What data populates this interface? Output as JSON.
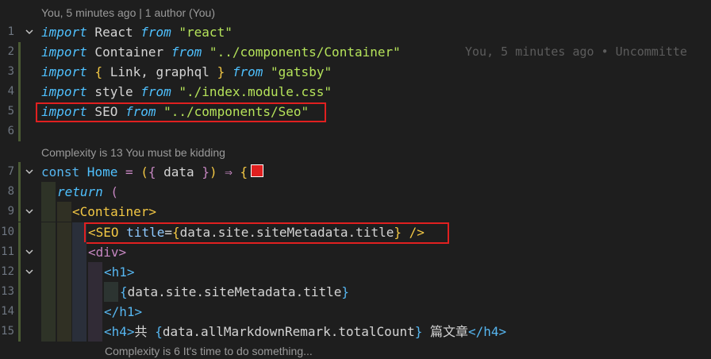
{
  "blame_header": "You, 5 minutes ago | 1 author (You)",
  "complexity_1": "Complexity is 13 You must be kidding",
  "complexity_2": "Complexity is 6 It's time to do something...",
  "blame_inline": "You, 5 minutes ago • Uncommitte",
  "line_numbers": [
    "1",
    "2",
    "3",
    "4",
    "5",
    "6",
    "7",
    "8",
    "9",
    "10",
    "11",
    "12",
    "13",
    "14",
    "15"
  ],
  "code": {
    "l1": {
      "kw": "import",
      "name": " React ",
      "from": "from",
      "str": " \"react\""
    },
    "l2": {
      "kw": "import",
      "name": " Container ",
      "from": "from",
      "str": " \"../components/Container\""
    },
    "l3": {
      "kw": "import",
      "b1": "{",
      "names": " Link, graphql ",
      "b2": "}",
      "from": "from",
      "str": " \"gatsby\""
    },
    "l4": {
      "kw": "import",
      "name": " style ",
      "from": "from",
      "str": " \"./index.module.css\""
    },
    "l5": {
      "kw": "import",
      "name": " SEO ",
      "from": "from",
      "str": " \"../components/Seo\""
    },
    "l7": {
      "const": "const",
      "name": " Home ",
      "eq": "=",
      "p1": " (",
      "b1": "{",
      "arg": " data ",
      "b2": "}",
      "p2": ")",
      "arrow": " ⇒ ",
      "brace": "{"
    },
    "l8": {
      "ret": "return",
      "paren": " ("
    },
    "l9": {
      "open": "<",
      "tag": "Container",
      "close": ">"
    },
    "l10": {
      "open": "<",
      "tag": "SEO",
      "attr": " title",
      "eq": "=",
      "b1": "{",
      "expr": "data.site.siteMetadata.title",
      "b2": "}",
      "close": " />"
    },
    "l11": {
      "open": "<",
      "tag": "div",
      "close": ">"
    },
    "l12": {
      "open": "<",
      "tag": "h1",
      "close": ">"
    },
    "l13": {
      "b1": "{",
      "expr": "data.site.siteMetadata.title",
      "b2": "}"
    },
    "l14": {
      "open": "</",
      "tag": "h1",
      "close": ">"
    },
    "l15": {
      "open": "<",
      "tag": "h4",
      "close": ">",
      "text1": "共 ",
      "b1": "{",
      "expr": "data.allMarkdownRemark.totalCount",
      "b2": "}",
      "text2": " 篇文章",
      "open2": "</",
      "tag2": "h4",
      "close2": ">"
    }
  },
  "colors": {
    "highlight": "#e02020",
    "background": "#1e1e1e"
  }
}
